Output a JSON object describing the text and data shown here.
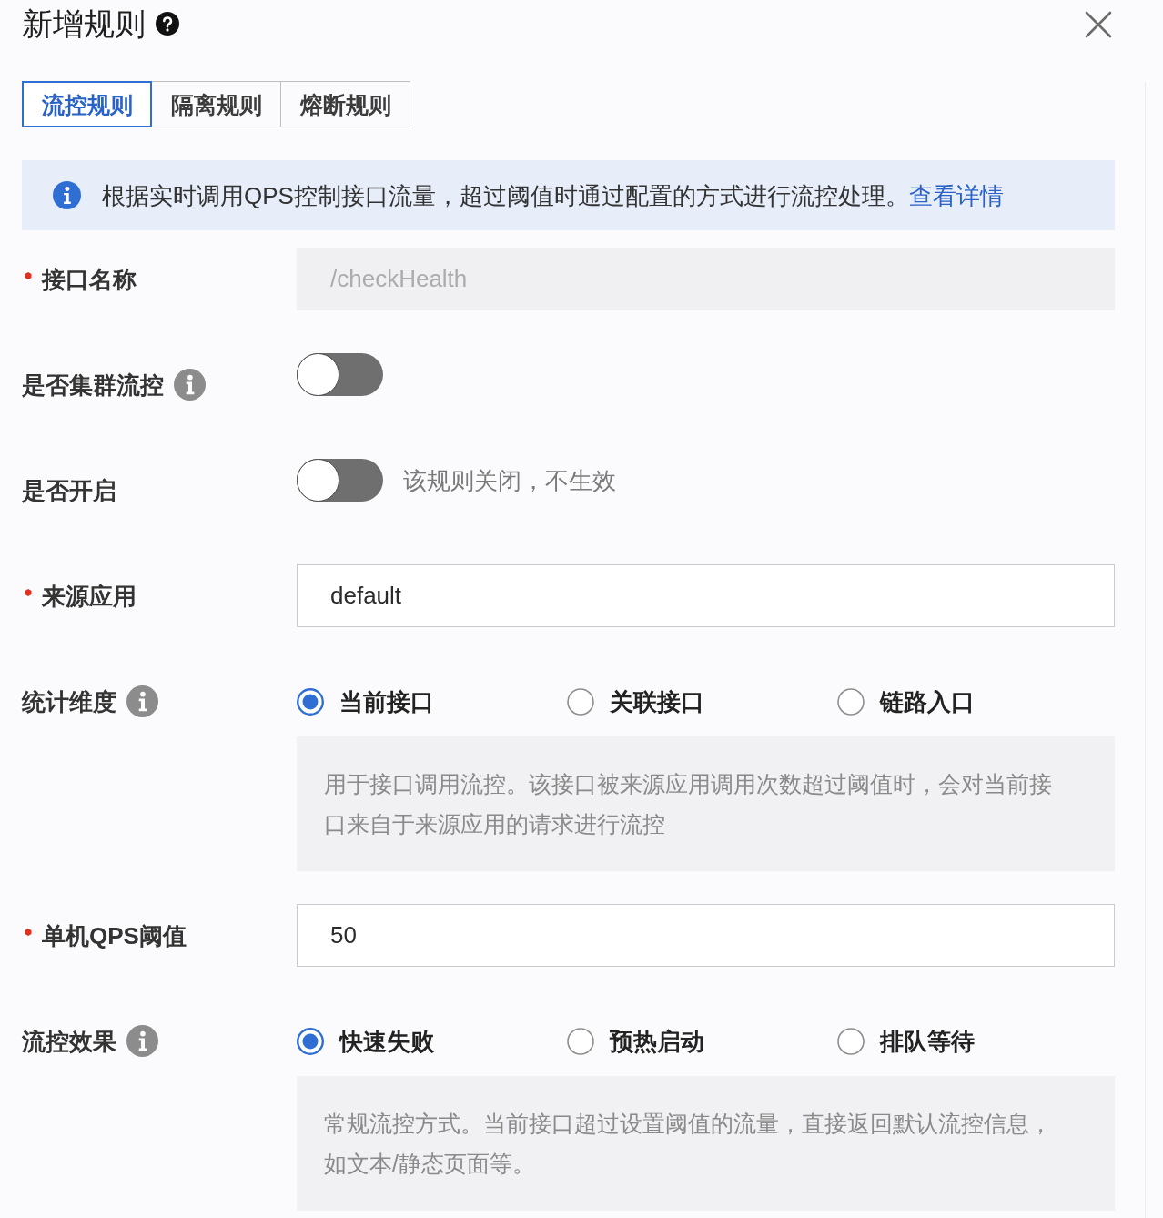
{
  "dialog": {
    "title": "新增规则"
  },
  "tabs": [
    {
      "label": "流控规则",
      "selected": true
    },
    {
      "label": "隔离规则",
      "selected": false
    },
    {
      "label": "熔断规则",
      "selected": false
    }
  ],
  "alert": {
    "text": "根据实时调用QPS控制接口流量，超过阈值时通过配置的方式进行流控处理。",
    "link": "查看详情"
  },
  "form": {
    "fields": [
      {
        "kind": "input",
        "label": "接口名称",
        "required": true,
        "info": false,
        "value": "/checkHealth",
        "disabled": true
      },
      {
        "kind": "switch",
        "label": "是否集群流控",
        "required": false,
        "info": true,
        "on": false
      },
      {
        "kind": "switch",
        "label": "是否开启",
        "required": false,
        "info": false,
        "on": false,
        "hint": "该规则关闭，不生效"
      },
      {
        "kind": "input",
        "label": "来源应用",
        "required": true,
        "info": false,
        "value": "default",
        "disabled": false
      },
      {
        "kind": "radio",
        "label": "统计维度",
        "required": false,
        "info": true,
        "options": [
          {
            "label": "当前接口",
            "selected": true
          },
          {
            "label": "关联接口",
            "selected": false
          },
          {
            "label": "链路入口",
            "selected": false
          }
        ],
        "description": "用于接口调用流控。该接口被来源应用调用次数超过阈值时，会对当前接口来自于来源应用的请求进行流控"
      },
      {
        "kind": "input",
        "label": "单机QPS阈值",
        "required": true,
        "info": false,
        "value": "50",
        "disabled": false
      },
      {
        "kind": "radio",
        "label": "流控效果",
        "required": false,
        "info": true,
        "options": [
          {
            "label": "快速失败",
            "selected": true
          },
          {
            "label": "预热启动",
            "selected": false
          },
          {
            "label": "排队等待",
            "selected": false
          }
        ],
        "description": "常规流控方式。当前接口超过设置阈值的流量，直接返回默认流控信息，如文本/静态页面等。"
      }
    ]
  }
}
